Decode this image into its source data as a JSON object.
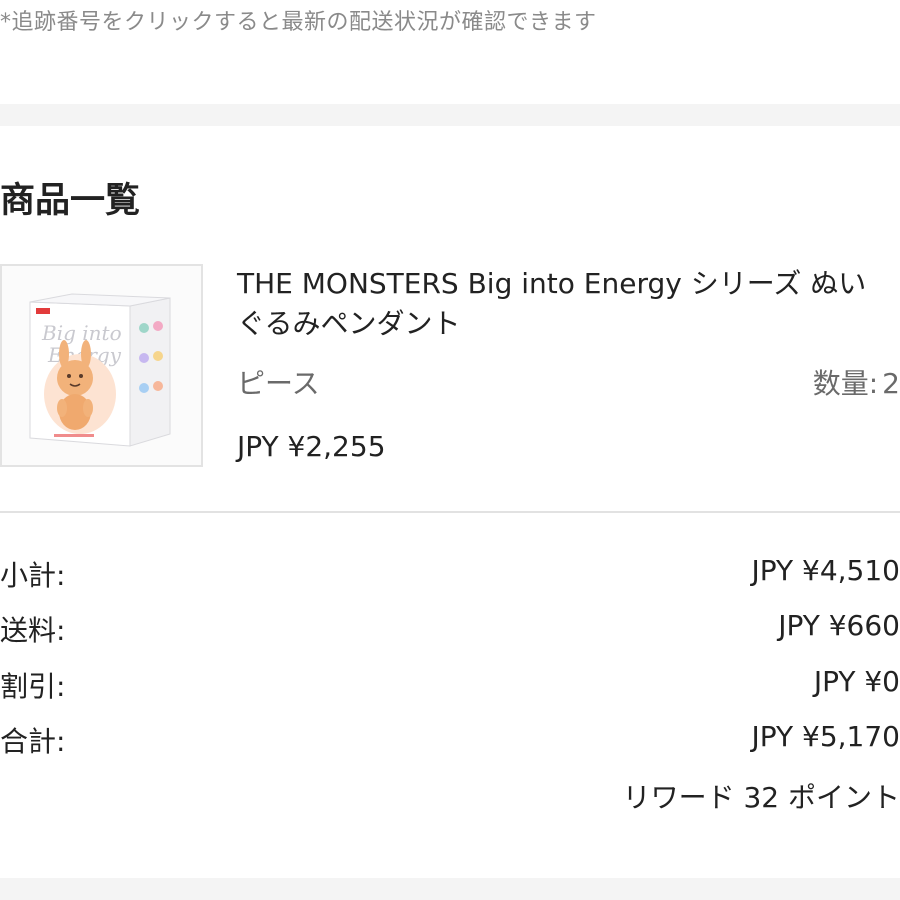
{
  "tracking_note": "*追跡番号をクリックすると最新の配送状況が確認できます",
  "section_title": "商品一覧",
  "product": {
    "name_line1": "THE MONSTERS Big into Energy シリーズ ぬい",
    "name_line2": "ぐるみペンダント",
    "variant": "ピース",
    "quantity_label": "数量:",
    "quantity_value": "2",
    "price": "JPY ¥2,255",
    "image_icon": "product-box-image",
    "image_text": "Big into Energy"
  },
  "summary": {
    "subtotal_label": "小計:",
    "subtotal_value": "JPY ¥4,510",
    "shipping_label": "送料:",
    "shipping_value": "JPY ¥660",
    "discount_label": "割引:",
    "discount_value": "JPY ¥0",
    "total_label": "合計:",
    "total_value": "JPY ¥5,170",
    "reward": "リワード 32 ポイント"
  },
  "colors": {
    "band": "#f4f4f4",
    "divider": "#e2e2e2",
    "muted_text": "#8a8a8a",
    "figure_orange": "#f2b27a"
  }
}
